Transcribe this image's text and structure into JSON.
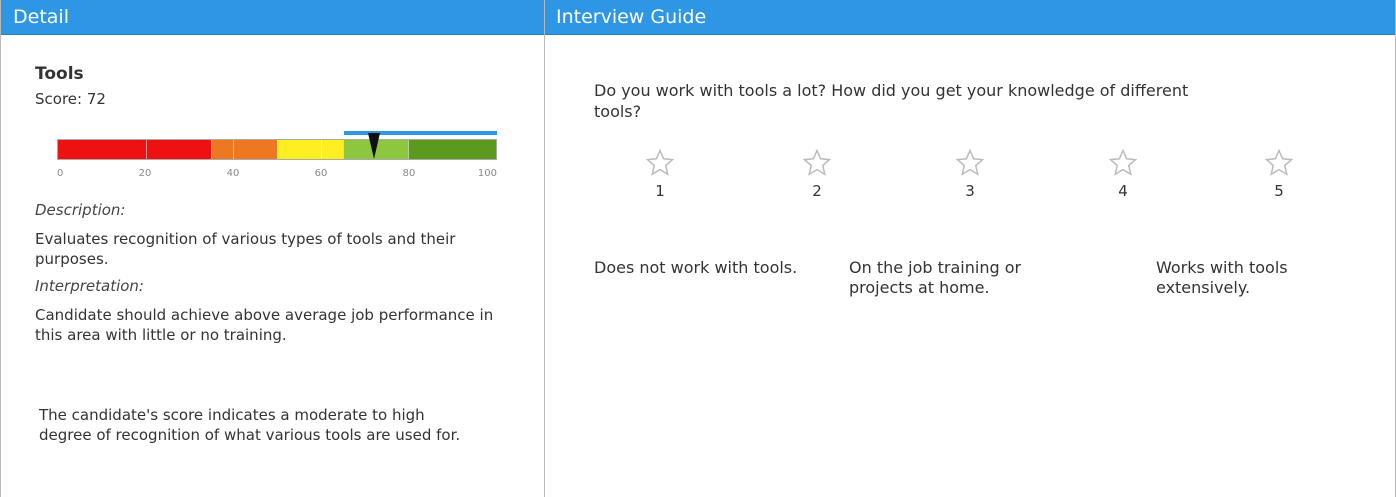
{
  "detail": {
    "header": "Detail",
    "title": "Tools",
    "score_text": "Score: 72",
    "score_value": 72,
    "scale": {
      "min": 0,
      "max": 100,
      "ticks": [
        "0",
        "20",
        "40",
        "60",
        "80",
        "100"
      ],
      "target_range": [
        67,
        100
      ],
      "bands": [
        {
          "from": 0,
          "to": 20,
          "color": "#ee1111"
        },
        {
          "from": 20,
          "to": 35,
          "color": "#ee1111"
        },
        {
          "from": 35,
          "to": 40,
          "color": "#ee7722"
        },
        {
          "from": 40,
          "to": 50,
          "color": "#ee7722"
        },
        {
          "from": 50,
          "to": 60,
          "color": "#ffee22"
        },
        {
          "from": 60,
          "to": 65,
          "color": "#ffee22"
        },
        {
          "from": 65,
          "to": 80,
          "color": "#8dc63f"
        },
        {
          "from": 80,
          "to": 100,
          "color": "#5b9a1e"
        }
      ],
      "range_color": "#2d97e6"
    },
    "description_label": "Description:",
    "description": "Evaluates recognition of various types of tools and their purposes.",
    "interpretation_label": "Interpretation:",
    "interpretation": "Candidate should achieve above average job performance in this area with little or no training.",
    "summary": "The candidate's score indicates a moderate to high degree of recognition of what various tools are used for."
  },
  "interview": {
    "header": "Interview Guide",
    "question": "Do you work with tools a lot? How did you get your knowledge of different tools?",
    "ratings": [
      {
        "number": "1",
        "icon": "star-outline-icon"
      },
      {
        "number": "2",
        "icon": "star-outline-icon"
      },
      {
        "number": "3",
        "icon": "star-outline-icon"
      },
      {
        "number": "4",
        "icon": "star-outline-icon"
      },
      {
        "number": "5",
        "icon": "star-outline-icon"
      }
    ],
    "anchors": {
      "low": "Does not work with tools.",
      "mid": "On the job training or projects at home.",
      "high": "Works with tools extensively."
    }
  }
}
